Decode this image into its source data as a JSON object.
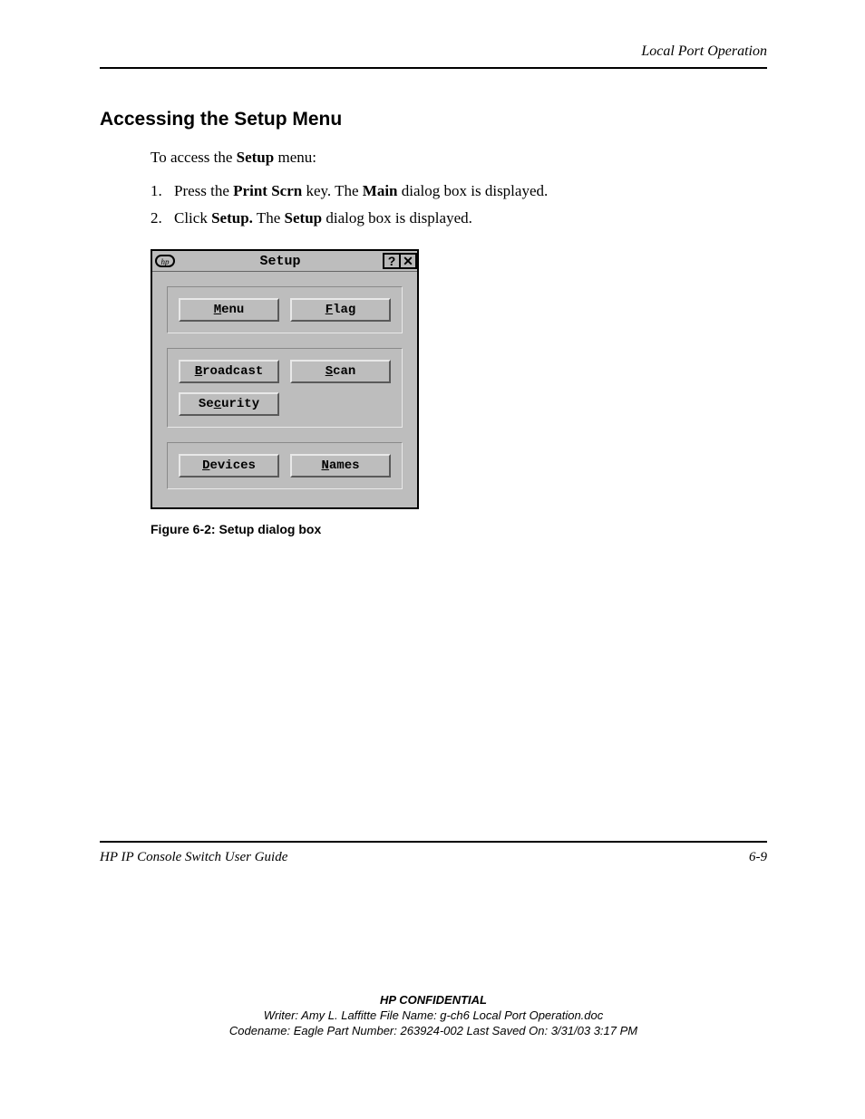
{
  "header": {
    "section_name": "Local Port Operation"
  },
  "section_title": "Accessing the Setup Menu",
  "intro": {
    "pre": "To access the ",
    "bold": "Setup",
    "post": " menu:"
  },
  "steps": [
    {
      "num": "1.",
      "pre": "Press the ",
      "b1": "Print Scrn",
      "mid": " key. The ",
      "b2": "Main",
      "post": " dialog box is displayed."
    },
    {
      "num": "2.",
      "pre": "Click ",
      "b1": "Setup.",
      "mid": " The ",
      "b2": "Setup",
      "post": " dialog box is displayed."
    }
  ],
  "dialog": {
    "title": "Setup",
    "help_glyph": "?",
    "close_glyph": "✕",
    "buttons": {
      "menu": {
        "u": "M",
        "rest": "enu"
      },
      "flag": {
        "u": "F",
        "rest": "lag"
      },
      "broadcast": {
        "u": "B",
        "rest": "roadcast"
      },
      "scan": {
        "u": "S",
        "rest": "can"
      },
      "security": {
        "pre": "Se",
        "u": "c",
        "rest": "urity"
      },
      "devices": {
        "u": "D",
        "rest": "evices"
      },
      "names": {
        "u": "N",
        "rest": "ames"
      }
    }
  },
  "figure_caption": "Figure 6-2:  Setup dialog box",
  "footer": {
    "guide_title": "HP IP Console Switch User Guide",
    "page_number": "6-9"
  },
  "confidential": {
    "title": "HP CONFIDENTIAL",
    "line1": "Writer: Amy L. Laffitte File Name: g-ch6 Local Port Operation.doc",
    "line2": "Codename: Eagle Part Number: 263924-002 Last Saved On: 3/31/03 3:17 PM"
  }
}
